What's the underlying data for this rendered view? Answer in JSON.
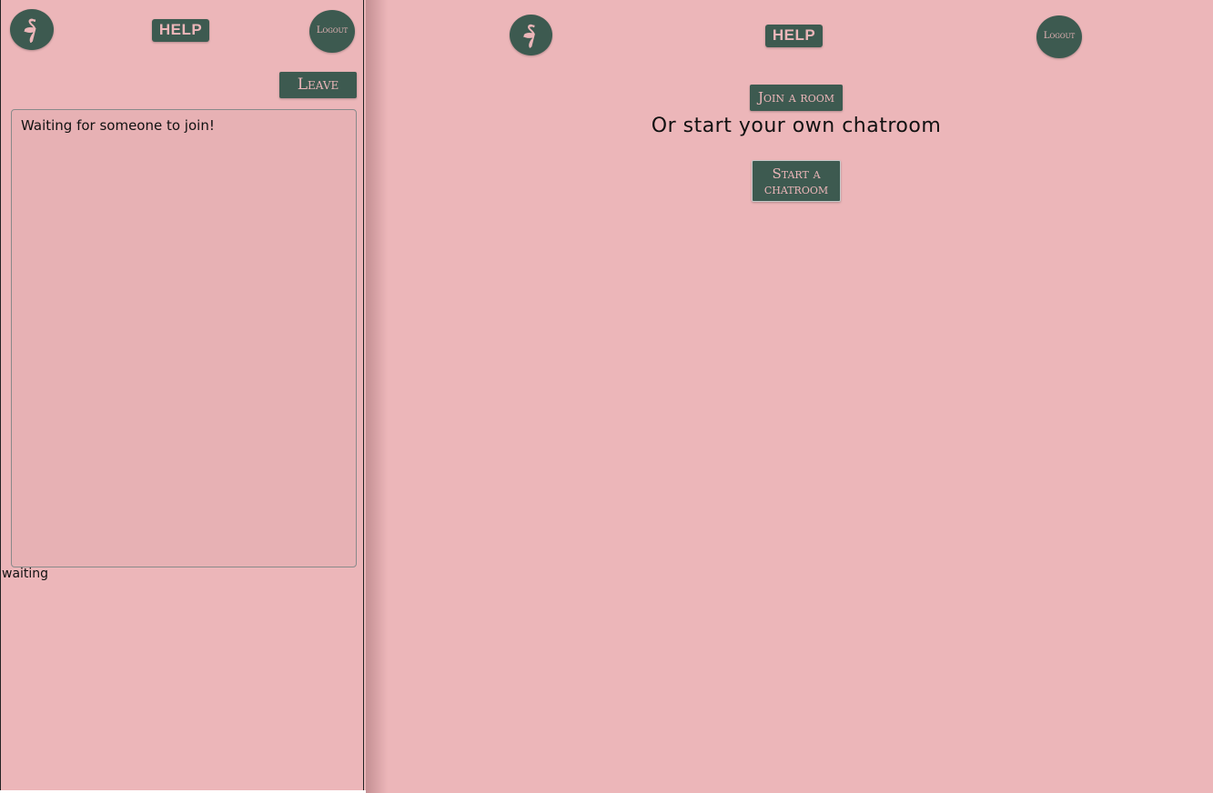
{
  "colors": {
    "background": "#ecb6b9",
    "button": "#3d5a50",
    "button_text": "#ecb6b9",
    "chat_box": "#e7b1b4"
  },
  "left_pane": {
    "header": {
      "logo_icon": "flamingo-icon",
      "help_label": "HELP",
      "logout_label": "Logout"
    },
    "leave_label": "Leave",
    "chat_message": "Waiting for someone to join!",
    "status": "waiting"
  },
  "right_pane": {
    "header": {
      "logo_icon": "flamingo-icon",
      "help_label": "HELP",
      "logout_label": "Logout"
    },
    "join_label": "Join a room",
    "or_text": "Or start your own chatroom",
    "start_label": "Start a chatroom"
  }
}
